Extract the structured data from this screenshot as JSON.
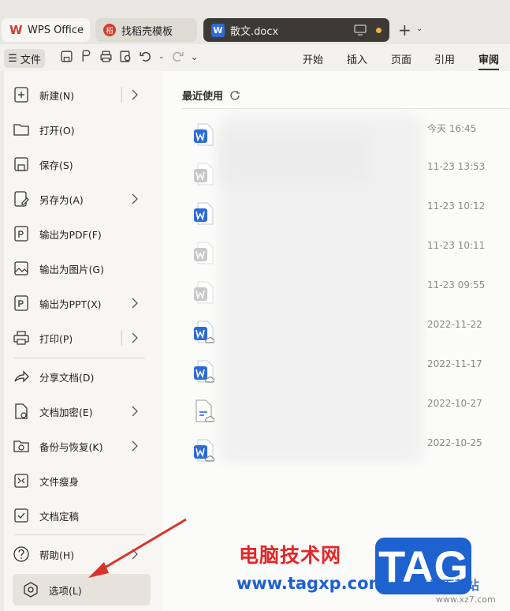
{
  "tabs": {
    "wps": "WPS Office",
    "template": "找稻壳模板",
    "doc": "散文.docx",
    "doc_icon": "W"
  },
  "toolbar": {
    "file_label": "文件",
    "ribbon": [
      "开始",
      "插入",
      "页面",
      "引用",
      "审阅"
    ]
  },
  "menu": {
    "items": [
      {
        "label": "新建(N)",
        "icon": "new-doc-icon"
      },
      {
        "label": "打开(O)",
        "icon": "folder-icon"
      },
      {
        "label": "保存(S)",
        "icon": "save-icon"
      },
      {
        "label": "另存为(A)",
        "icon": "save-as-icon"
      },
      {
        "label": "输出为PDF(F)",
        "icon": "pdf-icon"
      },
      {
        "label": "输出为图片(G)",
        "icon": "image-icon"
      },
      {
        "label": "输出为PPT(X)",
        "icon": "ppt-icon"
      },
      {
        "label": "打印(P)",
        "icon": "print-icon"
      },
      {
        "label": "分享文档(D)",
        "icon": "share-icon"
      },
      {
        "label": "文档加密(E)",
        "icon": "lock-icon"
      },
      {
        "label": "备份与恢复(K)",
        "icon": "backup-icon"
      },
      {
        "label": "文件瘦身",
        "icon": "compress-icon"
      },
      {
        "label": "文档定稿",
        "icon": "finalize-icon"
      },
      {
        "label": "帮助(H)",
        "icon": "help-icon"
      },
      {
        "label": "选项(L)",
        "icon": "settings-icon"
      }
    ]
  },
  "recent": {
    "title": "最近使用",
    "dates": [
      "今天  16:45",
      "11-23 13:53",
      "11-23 10:12",
      "11-23 10:11",
      "11-23 09:55",
      "2022-11-22",
      "2022-11-17",
      "2022-10-27",
      "2022-10-25"
    ]
  },
  "watermark": {
    "cn": "电脑技术网",
    "url": "www.tagxp.com",
    "tag": "TAG",
    "site": "极光下载站",
    "site_url": "www.xz7.com"
  },
  "colors": {
    "accent_blue": "#2d6bd6",
    "arrow_red": "#d8322b"
  }
}
